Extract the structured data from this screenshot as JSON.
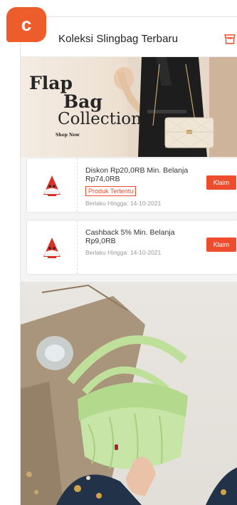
{
  "figure": {
    "panel_label": "c"
  },
  "header": {
    "title": "Koleksi Slingbag Terbaru",
    "shop_icon": "shop-icon"
  },
  "banner": {
    "line1": "Flap",
    "line2": "Bag",
    "line3": "Collection",
    "cta": "Shop Now"
  },
  "vouchers": [
    {
      "title": "Diskon Rp20,0RB Min. Belanja Rp74,0RB",
      "tag": "Produk Tertentu",
      "expiry": "Berlaku Hingga: 14-10-2021",
      "button": "Klaim"
    },
    {
      "title": "Cashback 5% Min. Belanja Rp9,0RB",
      "expiry": "Berlaku Hingga: 14-10-2021",
      "button": "Klaim"
    }
  ],
  "colors": {
    "accent": "#ee4d2d",
    "badge": "#ec5d2b"
  }
}
